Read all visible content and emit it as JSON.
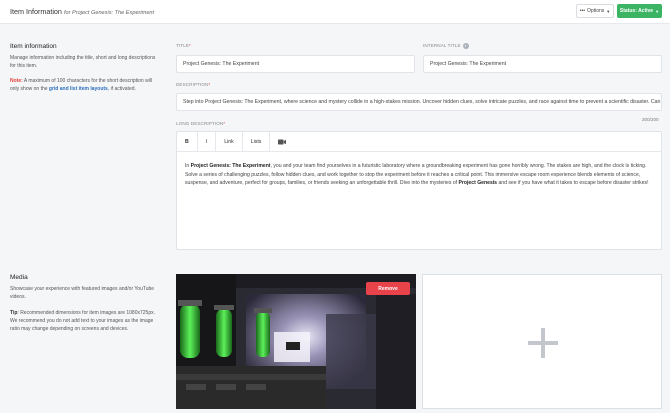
{
  "header": {
    "title": "Item Information",
    "subtitle": "for Project Genesis: The Experiment",
    "options_label": "Options",
    "status_label": "Status: Active",
    "status_color": "#3bb464"
  },
  "item_info": {
    "heading": "Item information",
    "description": "Manage information including the title, short and long descriptions for this item.",
    "note_label": "Note:",
    "note_pre": "A maximum of 100 characters for the short description will only show on the",
    "note_link": "grid and list item layouts",
    "note_post": ", if activated."
  },
  "fields": {
    "title_label": "TITLE",
    "title_value": "Project Genesis: The Experiment",
    "internal_title_label": "INTERNAL TITLE",
    "internal_title_value": "Project Genesis: The Experiment",
    "description_label": "DESCRIPTION",
    "description_value": "Step into Project Genesis: The Experiment, where science and mystery collide in a high-stakes mission. Uncover hidden clues, solve intricate puzzles, and race against time to prevent a scientific disaster. Can",
    "description_counter": "200/200",
    "long_description_label": "LONG DESCRIPTION"
  },
  "editor": {
    "toolbar": {
      "bold": "B",
      "italic": "I",
      "link": "Link",
      "lists": "Lists",
      "media_icon": "camera-icon"
    },
    "p1": "In ",
    "b1": "Project Genesis: The Experiment",
    "p2": ", you and your team find yourselves in a futuristic laboratory where a groundbreaking experiment has gone horribly wrong. The stakes are high, and the clock is ticking. Solve a series of challenging puzzles, follow hidden clues, and work together to stop the experiment before it reaches a critical point. This immersive escape room experience blends elements of science, suspense, and adventure, perfect for groups, families, or friends seeking an unforgettable thrill. Dive into the mysteries of ",
    "b2": "Project Genesis",
    "p3": " and see if you have what it takes to escape before disaster strikes!"
  },
  "media": {
    "heading": "Media",
    "description": "Showcase your experience with featured images and/or YouTube videos.",
    "tip_label": "Tip",
    "tip_text": ": Recommended dimensions for item images are 1080x725px. We recommend you do not add text to your images as the image ratio may change depending on screens and devices.",
    "remove_label": "Remove",
    "add_icon": "plus-icon"
  }
}
